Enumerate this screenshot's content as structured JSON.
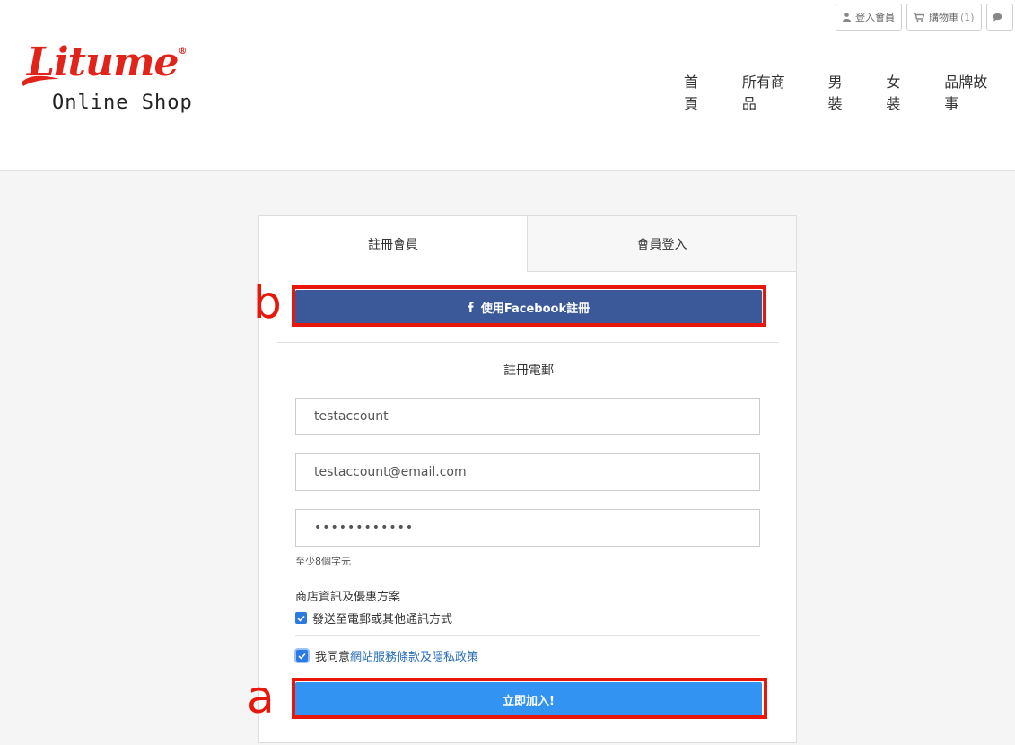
{
  "top_util": {
    "login_label": "登入會員",
    "cart_label": "購物車",
    "cart_count": "(1)"
  },
  "brand": {
    "logo_text": "Litume",
    "registered_mark": "®",
    "tagline": "Online Shop",
    "color": "#e2231a"
  },
  "nav": {
    "items": [
      "首頁",
      "所有商品",
      "男裝",
      "女裝",
      "品牌故事"
    ]
  },
  "form": {
    "tabs": [
      "註冊會員",
      "會員登入"
    ],
    "facebook_button": "使用Facebook註冊",
    "section_title": "註冊電郵",
    "username_value": "testaccount",
    "email_value": "testaccount@email.com",
    "password_value": "••••••••••••",
    "password_hint": "至少8個字元",
    "promo_title": "商店資訊及優惠方案",
    "promo_checkbox_label": "發送至電郵或其他通訊方式",
    "agree_prefix": "我同意",
    "agree_link": "網站服務條款及隱私政策",
    "submit_button": "立即加入!"
  },
  "annotations": {
    "a": "a",
    "b": "b"
  },
  "colors": {
    "facebook": "#3b5998",
    "submit": "#3393f2",
    "annotation": "#e8170c",
    "link": "#2a6cb8"
  }
}
